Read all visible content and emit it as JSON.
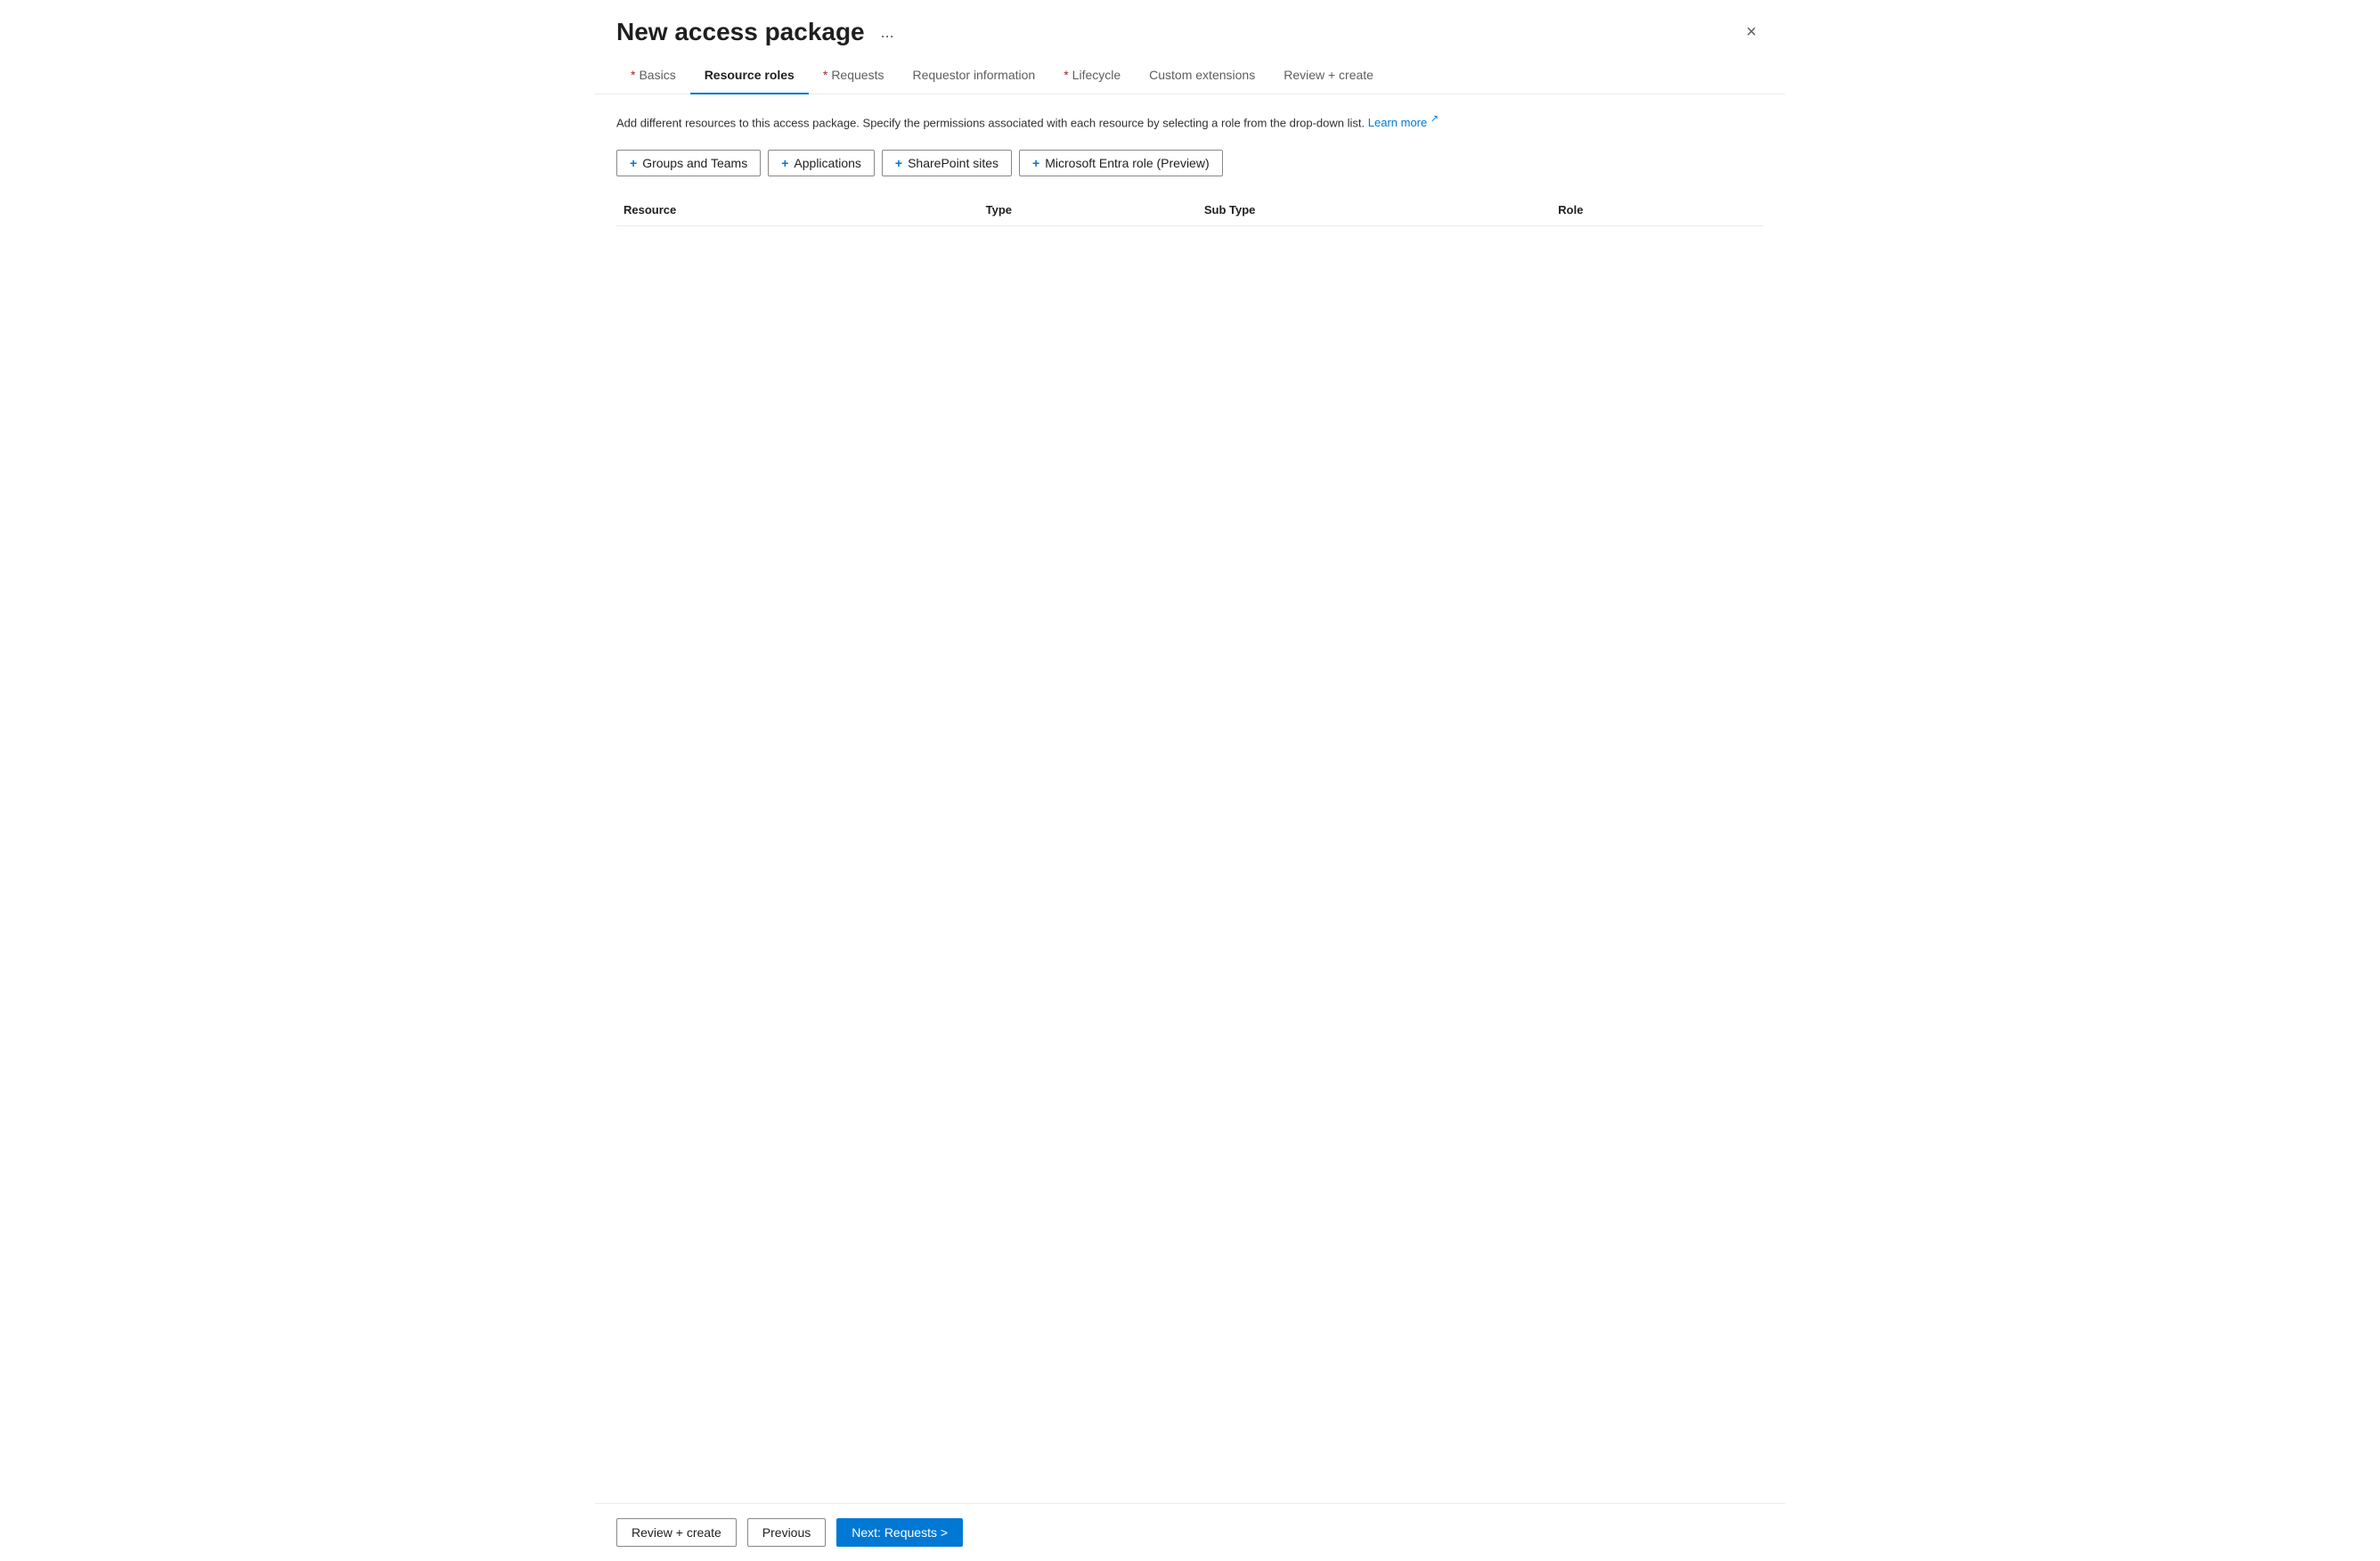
{
  "header": {
    "title": "New access package",
    "more_options_label": "...",
    "close_label": "×"
  },
  "tabs": [
    {
      "id": "basics",
      "label": "Basics",
      "required": true,
      "active": false
    },
    {
      "id": "resource-roles",
      "label": "Resource roles",
      "required": false,
      "active": true
    },
    {
      "id": "requests",
      "label": "Requests",
      "required": true,
      "active": false
    },
    {
      "id": "requestor-information",
      "label": "Requestor information",
      "required": false,
      "active": false
    },
    {
      "id": "lifecycle",
      "label": "Lifecycle",
      "required": true,
      "active": false
    },
    {
      "id": "custom-extensions",
      "label": "Custom extensions",
      "required": false,
      "active": false
    },
    {
      "id": "review-create",
      "label": "Review + create",
      "required": false,
      "active": false
    }
  ],
  "content": {
    "description": "Add different resources to this access package. Specify the permissions associated with each resource by selecting a role from the drop-down list.",
    "learn_more_label": "Learn more",
    "buttons": [
      {
        "id": "groups-teams",
        "label": "Groups and Teams"
      },
      {
        "id": "applications",
        "label": "Applications"
      },
      {
        "id": "sharepoint-sites",
        "label": "SharePoint sites"
      },
      {
        "id": "microsoft-entra-role",
        "label": "Microsoft Entra role (Preview)"
      }
    ],
    "table": {
      "columns": [
        {
          "id": "resource",
          "label": "Resource"
        },
        {
          "id": "type",
          "label": "Type"
        },
        {
          "id": "sub-type",
          "label": "Sub Type"
        },
        {
          "id": "role",
          "label": "Role"
        }
      ],
      "rows": []
    }
  },
  "footer": {
    "review_create_label": "Review + create",
    "previous_label": "Previous",
    "next_label": "Next: Requests >"
  }
}
